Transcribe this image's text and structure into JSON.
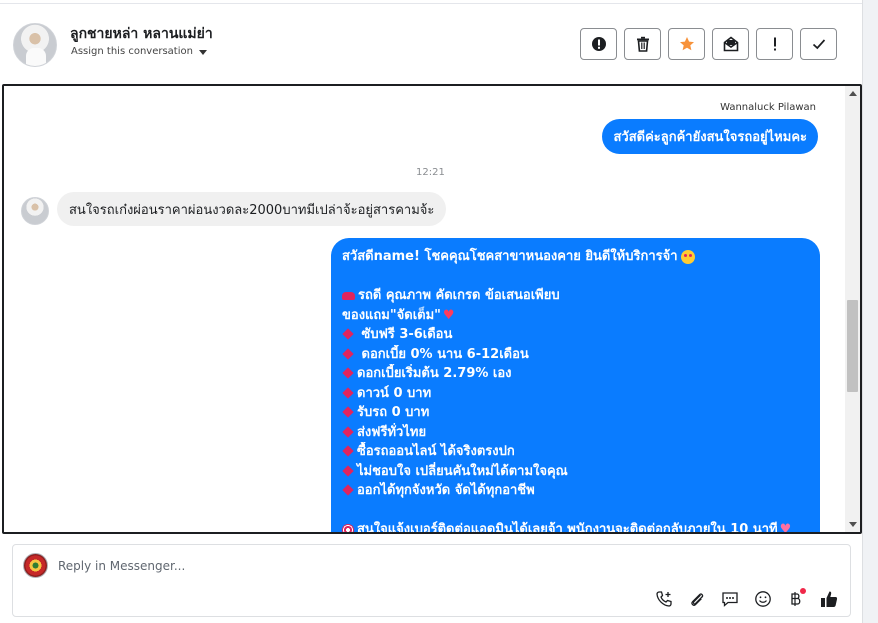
{
  "header": {
    "contact_name": "ลูกชายหล่า หลานแม่ย่า",
    "assign_label": "Assign this conversation",
    "actions": [
      {
        "name": "report-spam",
        "icon": "alert-circle-icon"
      },
      {
        "name": "delete",
        "icon": "trash-icon"
      },
      {
        "name": "star",
        "icon": "star-icon",
        "color": "#f7923a"
      },
      {
        "name": "mark-unread",
        "icon": "envelope-icon"
      },
      {
        "name": "priority",
        "icon": "exclamation-icon"
      },
      {
        "name": "mark-done",
        "icon": "checkmark-icon"
      }
    ]
  },
  "conversation": {
    "sender_name": "Wannaluck Pilawan",
    "outgoing_1": "สวัสดีค่ะลูกค้ายังสนใจรถอยู่ไหมคะ",
    "timestamp": "12:21",
    "incoming_1": "สนใจรถเก๋งผ่อนราคาผ่อนงวดละ2000บาทมีเปล่าจ้ะอยู่สารคามจ้ะ",
    "outgoing_2": {
      "greeting": "สวัสดีname! โชคคุณโชคสาขาหนองคาย ยินดีให้บริการจ้า",
      "headline": "รถดี คุณภาพ คัดเกรด ข้อเสนอเพียบ",
      "gift": "ของแถม\"จัดเต็ม\"",
      "items": [
        " ซับฟรี 3-6เดือน",
        " ดอกเบี้ย 0% นาน 6-12เดือน",
        "ดอกเบี้ยเริ่มต้น 2.79% เอง",
        "ดาวน์ 0 บาท",
        "รับรถ 0 บาท",
        "ส่งฟรีทั่วไทย",
        "ซื้อรถออนไลน์ ได้จริงตรงปก",
        "ไม่ชอบใจ เปลี่ยนคันใหม่ได้ตามใจคุณ",
        "ออกได้ทุกจังหวัด จัดได้ทุกอาชีพ"
      ],
      "closing": "สนใจแจ้งเบอร์ติดต่อแอดมินได้เลยจ้า พนักงานจะติดต่อกลับภายใน 10 นาที"
    },
    "accent_color": "#0a7cff"
  },
  "composer": {
    "placeholder": "Reply in Messenger...",
    "value": "",
    "tools": [
      "phone-add-icon",
      "paperclip-icon",
      "saved-replies-icon",
      "emoji-icon",
      "baht-payment-icon",
      "thumbs-up-icon"
    ]
  }
}
